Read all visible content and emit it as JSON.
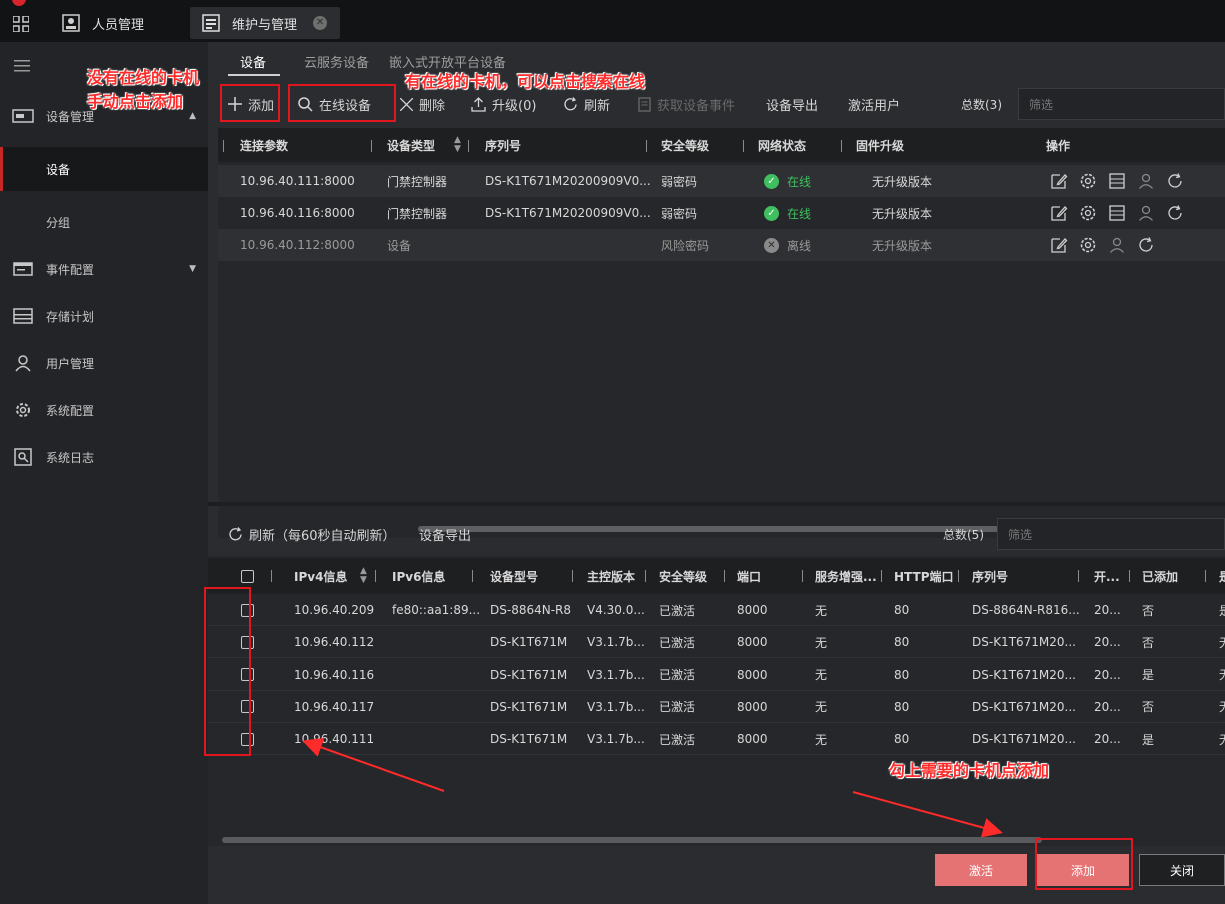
{
  "window": {
    "tabs": [
      {
        "label": "人员管理",
        "active": false
      },
      {
        "label": "维护与管理",
        "active": true
      }
    ]
  },
  "sidebar": {
    "items": [
      {
        "label": "设备管理",
        "icon": "device-icon",
        "expanded": true
      },
      {
        "label": "设备",
        "selected": true
      },
      {
        "label": "分组"
      },
      {
        "label": "事件配置",
        "icon": "event-icon"
      },
      {
        "label": "存储计划",
        "icon": "storage-icon"
      },
      {
        "label": "用户管理",
        "icon": "user-icon"
      },
      {
        "label": "系统配置",
        "icon": "gear-icon"
      },
      {
        "label": "系统日志",
        "icon": "log-icon"
      }
    ]
  },
  "subtabs": [
    "设备",
    "云服务设备",
    "嵌入式开放平台设备"
  ],
  "toolbar": {
    "add": "添加",
    "online_devices": "在线设备",
    "delete": "删除",
    "upgrade": "升级(0)",
    "refresh": "刷新",
    "get_events": "获取设备事件",
    "export": "设备导出",
    "activate_user": "激活用户",
    "total": "总数(3)",
    "filter_placeholder": "筛选"
  },
  "device_table": {
    "columns": [
      "连接参数",
      "设备类型",
      "序列号",
      "安全等级",
      "网络状态",
      "固件升级",
      "操作"
    ],
    "rows": [
      {
        "conn": "10.96.40.111:8000",
        "type": "门禁控制器",
        "serial": "DS-K1T671M20200909V0...",
        "security": "弱密码",
        "status": "在线",
        "firmware": "无升级版本",
        "online": true
      },
      {
        "conn": "10.96.40.116:8000",
        "type": "门禁控制器",
        "serial": "DS-K1T671M20200909V0...",
        "security": "弱密码",
        "status": "在线",
        "firmware": "无升级版本",
        "online": true
      },
      {
        "conn": "10.96.40.112:8000",
        "type": "设备",
        "serial": "",
        "security": "风险密码",
        "status": "离线",
        "firmware": "无升级版本",
        "online": false
      }
    ]
  },
  "online_toolbar": {
    "refresh": "刷新（每60秒自动刷新）",
    "export": "设备导出",
    "total": "总数(5)",
    "filter_placeholder": "筛选"
  },
  "online_table": {
    "columns": [
      "IPv4信息",
      "IPv6信息",
      "设备型号",
      "主控版本",
      "安全等级",
      "端口",
      "服务增强...",
      "HTTP端口",
      "序列号",
      "开...",
      "已添加",
      "是"
    ],
    "rows": [
      {
        "ipv4": "10.96.40.209",
        "ipv6": "fe80::aa1:89...",
        "model": "DS-8864N-R8",
        "version": "V4.30.0...",
        "security": "已激活",
        "port": "8000",
        "service": "无",
        "http": "80",
        "serial": "DS-8864N-R816...",
        "open": "20...",
        "added": "否",
        "extra": "是"
      },
      {
        "ipv4": "10.96.40.112",
        "ipv6": "",
        "model": "DS-K1T671M",
        "version": "V3.1.7b...",
        "security": "已激活",
        "port": "8000",
        "service": "无",
        "http": "80",
        "serial": "DS-K1T671M20...",
        "open": "20...",
        "added": "否",
        "extra": "无"
      },
      {
        "ipv4": "10.96.40.116",
        "ipv6": "",
        "model": "DS-K1T671M",
        "version": "V3.1.7b...",
        "security": "已激活",
        "port": "8000",
        "service": "无",
        "http": "80",
        "serial": "DS-K1T671M20...",
        "open": "20...",
        "added": "是",
        "extra": "无"
      },
      {
        "ipv4": "10.96.40.117",
        "ipv6": "",
        "model": "DS-K1T671M",
        "version": "V3.1.7b...",
        "security": "已激活",
        "port": "8000",
        "service": "无",
        "http": "80",
        "serial": "DS-K1T671M20...",
        "open": "20...",
        "added": "否",
        "extra": "无"
      },
      {
        "ipv4": "10.96.40.111",
        "ipv6": "",
        "model": "DS-K1T671M",
        "version": "V3.1.7b...",
        "security": "已激活",
        "port": "8000",
        "service": "无",
        "http": "80",
        "serial": "DS-K1T671M20...",
        "open": "20...",
        "added": "是",
        "extra": "无"
      }
    ]
  },
  "buttons": {
    "activate": "激活",
    "add": "添加",
    "close": "关闭"
  },
  "annotations": {
    "manual_line1": "没有在线的卡机",
    "manual_line2": "手动点击添加",
    "online_hint": "有在线的卡机，可以点击搜索在线",
    "check_hint": "勾上需要的卡机点添加"
  },
  "colors": {
    "annotation": "#ff2a2a",
    "online_green": "#3fbf5f",
    "primary_button": "#e57373",
    "selected_marker": "#c62828"
  }
}
